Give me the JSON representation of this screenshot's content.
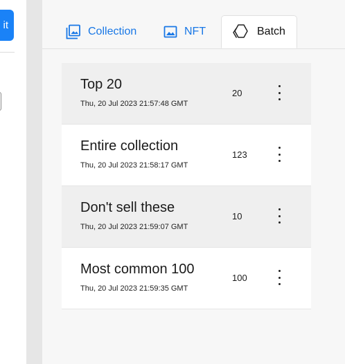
{
  "left": {
    "primary_button_label": "it"
  },
  "tabs": [
    {
      "label": "Collection",
      "icon": "image-stack-icon",
      "active": false
    },
    {
      "label": "NFT",
      "icon": "image-icon",
      "active": false
    },
    {
      "label": "Batch",
      "icon": "hexagon-stack-icon",
      "active": true
    }
  ],
  "batches": [
    {
      "title": "Top 20",
      "date": "Thu, 20 Jul 2023 21:57:48 GMT",
      "count": "20"
    },
    {
      "title": "Entire collection",
      "date": "Thu, 20 Jul 2023 21:58:17 GMT",
      "count": "123"
    },
    {
      "title": "Don't sell these",
      "date": "Thu, 20 Jul 2023 21:59:07 GMT",
      "count": "10"
    },
    {
      "title": "Most common 100",
      "date": "Thu, 20 Jul 2023 21:59:35 GMT",
      "count": "100"
    }
  ],
  "colors": {
    "accent": "#1877e6",
    "primary_button": "#1a82f7",
    "row_shaded": "#efefef",
    "panel_bg": "#f7f7f7"
  }
}
